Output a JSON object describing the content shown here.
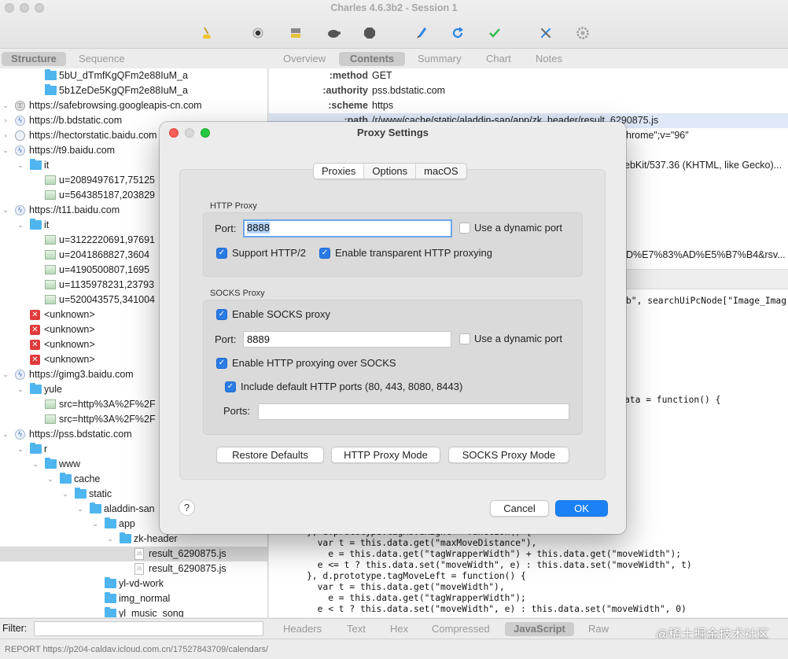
{
  "window": {
    "title": "Charles 4.6.3b2 - Session 1"
  },
  "toolbar": {
    "icons": [
      "broom-icon",
      "record-icon",
      "throttle-icon",
      "turtle-icon",
      "stop-icon",
      "pen-icon",
      "refresh-icon",
      "check-icon",
      "tools-icon",
      "settings-icon"
    ]
  },
  "left_tabs": [
    "Structure",
    "Sequence"
  ],
  "right_tabs": [
    "Overview",
    "Contents",
    "Summary",
    "Chart",
    "Notes"
  ],
  "tree": [
    {
      "label": "5bU_dTmfKgQFm2e88IuM_a",
      "icon": "folder"
    },
    {
      "label": "5b1ZeDe5KgQFm2e88IuM_a",
      "icon": "folder"
    },
    {
      "label": "https://safebrowsing.googleapis-cn.com",
      "icon": "lock"
    },
    {
      "label": "https://b.bdstatic.com",
      "icon": "bolt"
    },
    {
      "label": "https://hectorstatic.baidu.com",
      "icon": "globe"
    },
    {
      "label": "https://t9.baidu.com",
      "icon": "bolt"
    },
    {
      "label": "it",
      "icon": "folder"
    },
    {
      "label": "u=2089497617,75125",
      "icon": "image"
    },
    {
      "label": "u=564385187,203829",
      "icon": "image"
    },
    {
      "label": "https://t11.baidu.com",
      "icon": "bolt"
    },
    {
      "label": "it",
      "icon": "folder"
    },
    {
      "label": "u=3122220691,97691",
      "icon": "image"
    },
    {
      "label": "u=2041868827,3604",
      "icon": "image"
    },
    {
      "label": "u=4190500807,1695",
      "icon": "image"
    },
    {
      "label": "u=1135978231,23793",
      "icon": "image"
    },
    {
      "label": "u=520043575,341004",
      "icon": "image"
    },
    {
      "label": "<unknown>",
      "icon": "error"
    },
    {
      "label": "<unknown>",
      "icon": "error"
    },
    {
      "label": "<unknown>",
      "icon": "error"
    },
    {
      "label": "<unknown>",
      "icon": "error"
    },
    {
      "label": "https://gimg3.baidu.com",
      "icon": "bolt"
    },
    {
      "label": "yule",
      "icon": "folder"
    },
    {
      "label": "src=http%3A%2F%2F",
      "icon": "image"
    },
    {
      "label": "src=http%3A%2F%2F",
      "icon": "image"
    },
    {
      "label": "https://pss.bdstatic.com",
      "icon": "bolt"
    },
    {
      "label": "r",
      "icon": "folder"
    },
    {
      "label": "www",
      "icon": "folder"
    },
    {
      "label": "cache",
      "icon": "folder"
    },
    {
      "label": "static",
      "icon": "folder"
    },
    {
      "label": "aladdin-san",
      "icon": "folder"
    },
    {
      "label": "app",
      "icon": "folder"
    },
    {
      "label": "zk-header",
      "icon": "folder"
    },
    {
      "label": "result_6290875.js",
      "icon": "js"
    },
    {
      "label": "result_6290875.js",
      "icon": "js"
    },
    {
      "label": "yl-vd-work",
      "icon": "folder"
    },
    {
      "label": "img_normal",
      "icon": "folder"
    },
    {
      "label": "yl_music_song",
      "icon": "folder"
    }
  ],
  "filter": {
    "label": "Filter:",
    "value": ""
  },
  "headers": [
    {
      "key": ":method",
      "value": "GET"
    },
    {
      "key": ":authority",
      "value": "pss.bdstatic.com"
    },
    {
      "key": ":scheme",
      "value": "https"
    },
    {
      "key": ":path",
      "value": "/r/www/cache/static/aladdin-san/app/zk_header/result_6290875.js"
    }
  ],
  "header_snippets": {
    "ua_brand": "hrome\";v=\"96\"",
    "ua": "ebKit/537.36 (KHTML, like Gecko)...",
    "referer": "D%E7%83%AD%E5%B7%B4&rsv..."
  },
  "code_lines": {
    "l1": "b\", searchUiPcNode[\"Image_Imag",
    "l2": "ata = function() {",
    "l3": "}, d.prototype.tagMoveRight = function() {",
    "l4": "  var t = this.data.get(\"maxMoveDistance\"),",
    "l5": "    e = this.data.get(\"tagWrapperWidth\") + this.data.get(\"moveWidth\");",
    "l6": "  e <= t ? this.data.set(\"moveWidth\", e) : this.data.set(\"moveWidth\", t)",
    "l7": "}, d.prototype.tagMoveLeft = function() {",
    "l8": "  var t = this.data.get(\"moveWidth\"),",
    "l9": "    e = this.data.get(\"tagWrapperWidth\");",
    "l10": "  e < t ? this.data.set(\"moveWidth\", e) : this.data.set(\"moveWidth\", 0)"
  },
  "bottom_tabs": [
    "Headers",
    "Text",
    "Hex",
    "Compressed",
    "JavaScript",
    "Raw"
  ],
  "status": "REPORT https://p204-caldav.icloud.com.cn/17527843709/calendars/",
  "watermark": "@稀土掘金技术社区",
  "dialog": {
    "title": "Proxy Settings",
    "tabs": [
      "Proxies",
      "Options",
      "macOS"
    ],
    "http": {
      "group_label": "HTTP Proxy",
      "port_label": "Port:",
      "port_value": "8888",
      "dynamic_label": "Use a dynamic port",
      "http2_label": "Support HTTP/2",
      "transparent_label": "Enable transparent HTTP proxying"
    },
    "socks": {
      "group_label": "SOCKS Proxy",
      "enable_label": "Enable SOCKS proxy",
      "port_label": "Port:",
      "port_value": "8889",
      "dynamic_label": "Use a dynamic port",
      "http_over_label": "Enable HTTP proxying over SOCKS",
      "include_label": "Include default HTTP ports (80, 443, 8080, 8443)",
      "ports_label": "Ports:",
      "ports_value": ""
    },
    "buttons": {
      "restore": "Restore Defaults",
      "http_mode": "HTTP Proxy Mode",
      "socks_mode": "SOCKS Proxy Mode",
      "help": "?",
      "cancel": "Cancel",
      "ok": "OK"
    }
  }
}
